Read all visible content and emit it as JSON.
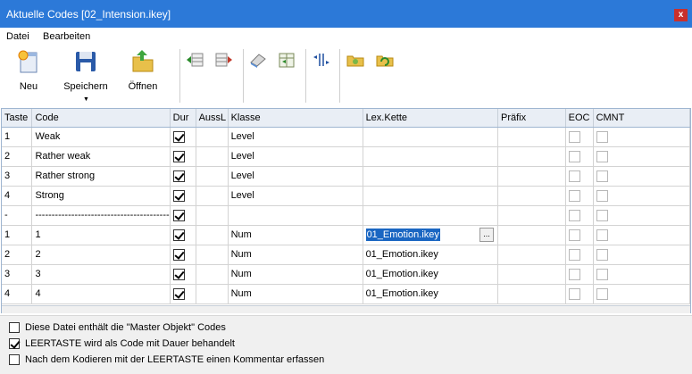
{
  "window": {
    "title": "Aktuelle Codes [02_Intension.ikey]",
    "close_label": "x"
  },
  "menu": {
    "items": [
      "Datei",
      "Bearbeiten"
    ]
  },
  "toolbar": {
    "new_label": "Neu",
    "save_label": "Speichern",
    "open_label": "Öffnen",
    "dropdown_arrow": "▼"
  },
  "table": {
    "columns": [
      "Taste",
      "Code",
      "Dur",
      "AussL",
      "Klasse",
      "Lex.Kette",
      "Präfix",
      "EOC",
      "CMNT"
    ],
    "rows": [
      {
        "taste": "1",
        "code": "Weak",
        "dur": true,
        "aussl": "",
        "klasse": "Level",
        "lex": "",
        "praefix": "",
        "eoc": false,
        "cmnt": false
      },
      {
        "taste": "2",
        "code": "Rather weak",
        "dur": true,
        "aussl": "",
        "klasse": "Level",
        "lex": "",
        "praefix": "",
        "eoc": false,
        "cmnt": false
      },
      {
        "taste": "3",
        "code": "Rather strong",
        "dur": true,
        "aussl": "",
        "klasse": "Level",
        "lex": "",
        "praefix": "",
        "eoc": false,
        "cmnt": false
      },
      {
        "taste": "4",
        "code": "Strong",
        "dur": true,
        "aussl": "",
        "klasse": "Level",
        "lex": "",
        "praefix": "",
        "eoc": false,
        "cmnt": false
      },
      {
        "taste": "-",
        "code": "-----------------------------------------",
        "dur": true,
        "aussl": "",
        "klasse": "",
        "lex": "",
        "praefix": "",
        "eoc": false,
        "cmnt": false
      },
      {
        "taste": "1",
        "code": "1",
        "dur": true,
        "aussl": "",
        "klasse": "Num",
        "lex": "01_Emotion.ikey",
        "praefix": "",
        "eoc": false,
        "cmnt": false,
        "editing": true
      },
      {
        "taste": "2",
        "code": "2",
        "dur": true,
        "aussl": "",
        "klasse": "Num",
        "lex": "01_Emotion.ikey",
        "praefix": "",
        "eoc": false,
        "cmnt": false
      },
      {
        "taste": "3",
        "code": "3",
        "dur": true,
        "aussl": "",
        "klasse": "Num",
        "lex": "01_Emotion.ikey",
        "praefix": "",
        "eoc": false,
        "cmnt": false
      },
      {
        "taste": "4",
        "code": "4",
        "dur": true,
        "aussl": "",
        "klasse": "Num",
        "lex": "01_Emotion.ikey",
        "praefix": "",
        "eoc": false,
        "cmnt": false
      }
    ],
    "ellipsis_label": "..."
  },
  "options": [
    {
      "label": "Diese Datei enthält die \"Master Objekt\" Codes",
      "checked": false
    },
    {
      "label": "LEERTASTE wird als Code mit Dauer behandelt",
      "checked": true
    },
    {
      "label": "Nach dem Kodieren mit der LEERTASTE einen Kommentar erfassen",
      "checked": false
    }
  ],
  "colors": {
    "titlebar": "#2c79d8",
    "close": "#c9302c",
    "selection": "#1a66c2"
  }
}
